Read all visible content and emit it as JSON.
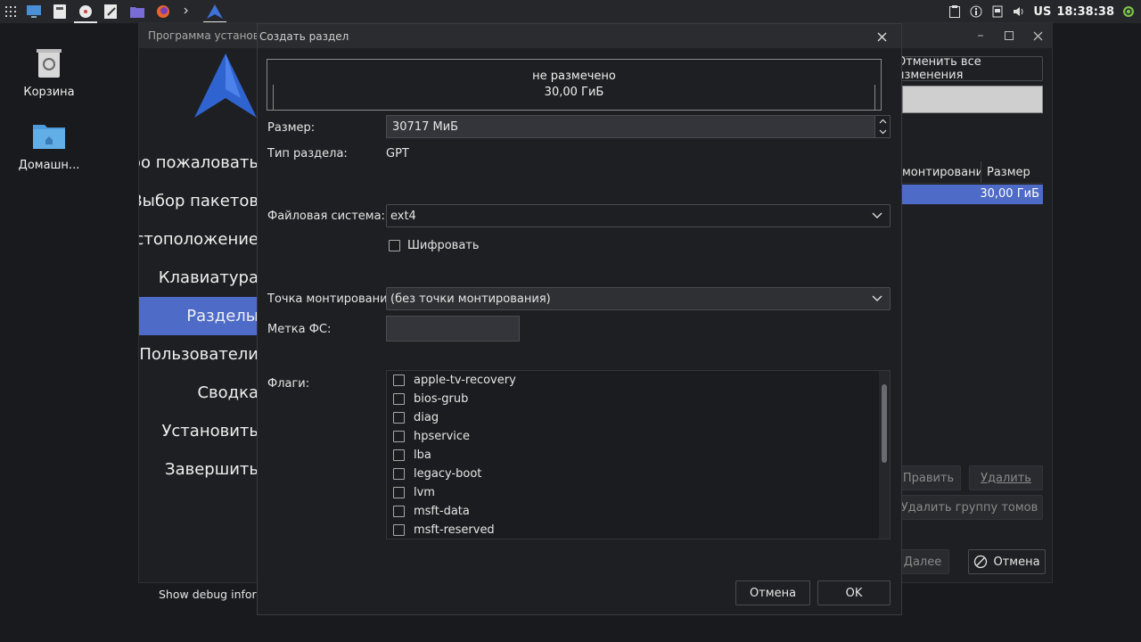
{
  "taskbar": {
    "clock": "18:38:38",
    "keyboard_layout": "US",
    "apps": [
      "app-grid-icon",
      "desktop-icon",
      "file-icon",
      "disk-icon",
      "editor-icon",
      "folder-icon",
      "firefox-icon",
      "terminal-icon",
      "installer-icon"
    ]
  },
  "desktop": {
    "icons": [
      {
        "label": "Корзина"
      },
      {
        "label": "Домашн..."
      }
    ]
  },
  "installer": {
    "title": "Программа установки",
    "steps": [
      {
        "label": "Добро пожаловать"
      },
      {
        "label": "Выбор пакетов"
      },
      {
        "label": "Местоположение"
      },
      {
        "label": "Клавиатура"
      },
      {
        "label": "Разделы",
        "active": true
      },
      {
        "label": "Пользователи"
      },
      {
        "label": "Сводка"
      },
      {
        "label": "Установить"
      },
      {
        "label": "Завершить"
      }
    ],
    "debug_label": "Show debug information",
    "revert_button": "Отменить все изменения",
    "table_headers": [
      "монтирования",
      "Размер"
    ],
    "table_row_size": "30,00 ГиБ",
    "edit_button": "Править",
    "delete_button": "Удалить",
    "delete_volume_group": "Удалить группу томов",
    "back_button": "Далее",
    "cancel_button": "Отмена"
  },
  "dialog": {
    "title": "Создать раздел",
    "partition": {
      "label": "не размечено",
      "size": "30,00 ГиБ"
    },
    "size_label": "Размер:",
    "size_value": "30717 МиБ",
    "type_label": "Тип раздела:",
    "type_value": "GPT",
    "fs_label": "Файловая система:",
    "fs_value": "ext4",
    "encrypt_label": "Шифровать",
    "mount_label": "Точка монтирования",
    "mount_value": "(без точки монтирования)",
    "fslabel_label": "Метка ФС:",
    "fslabel_value": "",
    "flags_label": "Флаги:",
    "flags": [
      "apple-tv-recovery",
      "bios-grub",
      "diag",
      "hpservice",
      "lba",
      "legacy-boot",
      "lvm",
      "msft-data",
      "msft-reserved"
    ],
    "cancel_button": "Отмена",
    "ok_button": "OK"
  },
  "colors": {
    "accent": "#4e6bc7",
    "background": "#191a1d",
    "panel": "#1e1f22"
  }
}
